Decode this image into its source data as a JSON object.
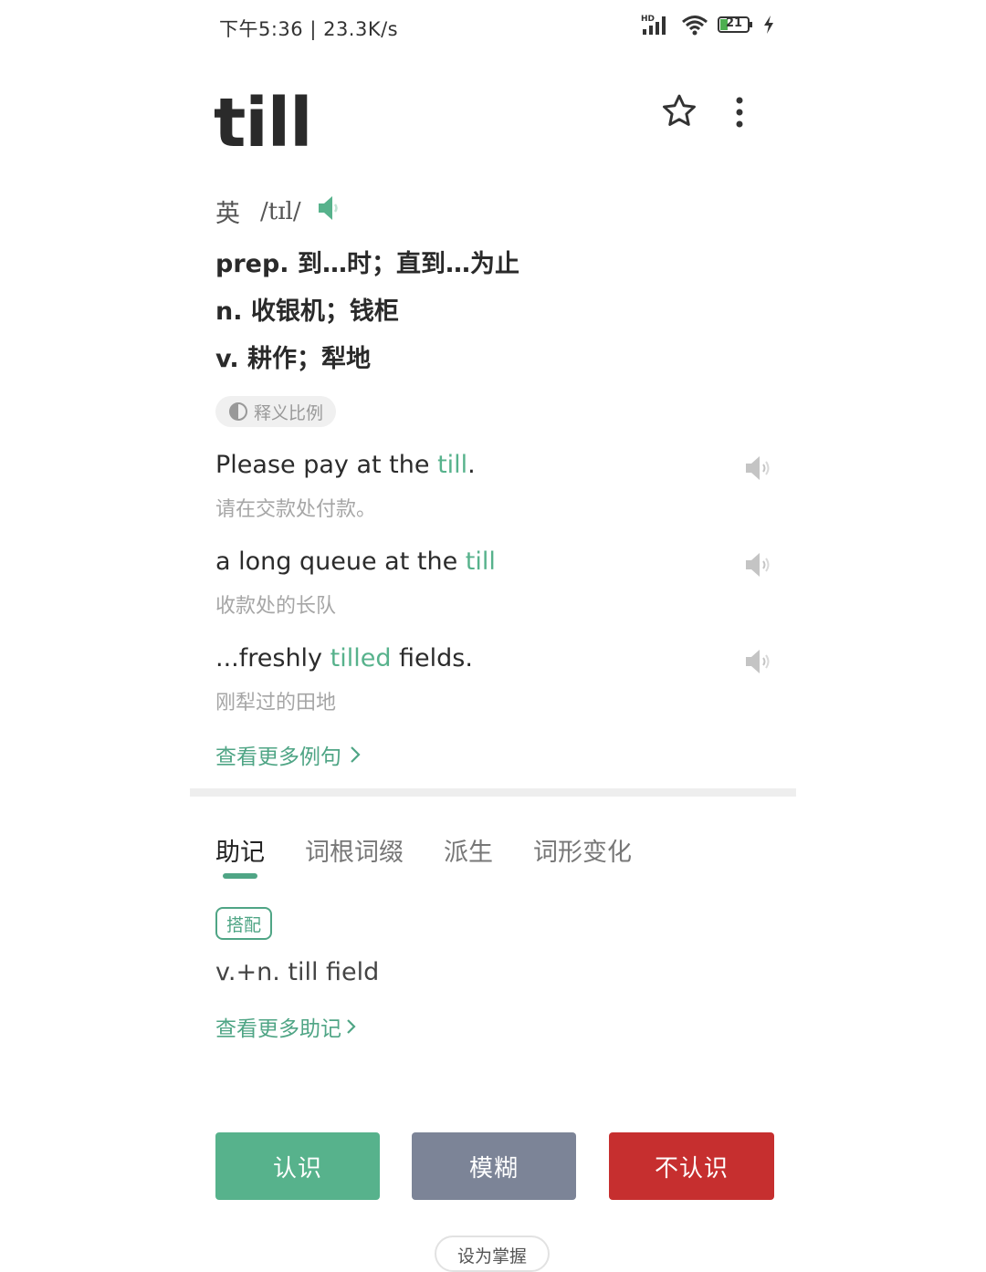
{
  "status_bar": {
    "time_speed": "下午5:36 | 23.3K/s",
    "network_label": "HD",
    "battery": "21"
  },
  "word": {
    "headword": "till",
    "accent": "英",
    "phonetic": "/tɪl/"
  },
  "definitions": [
    "prep. 到…时；直到…为止",
    "n. 收银机；钱柜",
    "v. 耕作；犁地"
  ],
  "ratio_chip": "释义比例",
  "examples": [
    {
      "before": "Please pay at the ",
      "highlight": "till",
      "after": ".",
      "translation": "请在交款处付款。"
    },
    {
      "before": "a long queue at the ",
      "highlight": "till",
      "after": "",
      "translation": "收款处的长队"
    },
    {
      "before": "...freshly ",
      "highlight": "tilled",
      "after": " fields.",
      "translation": "刚犁过的田地"
    }
  ],
  "more_examples": "查看更多例句",
  "tabs": [
    "助记",
    "词根词缀",
    "派生",
    "词形变化"
  ],
  "mnemonic": {
    "tag": "搭配",
    "phrase": "v.+n. till field",
    "more": "查看更多助记"
  },
  "actions": {
    "know": "认识",
    "fuzzy": "模糊",
    "unknown": "不认识",
    "master": "设为掌握"
  },
  "colors": {
    "accent": "#57b28c",
    "fuzzy": "#7c8497",
    "unknown": "#c62f2f"
  },
  "icons": [
    "signal-icon",
    "wifi-icon",
    "battery-icon",
    "charging-icon",
    "star-icon",
    "more-vertical-icon",
    "speaker-icon",
    "half-circle-icon",
    "chevron-right-icon"
  ]
}
